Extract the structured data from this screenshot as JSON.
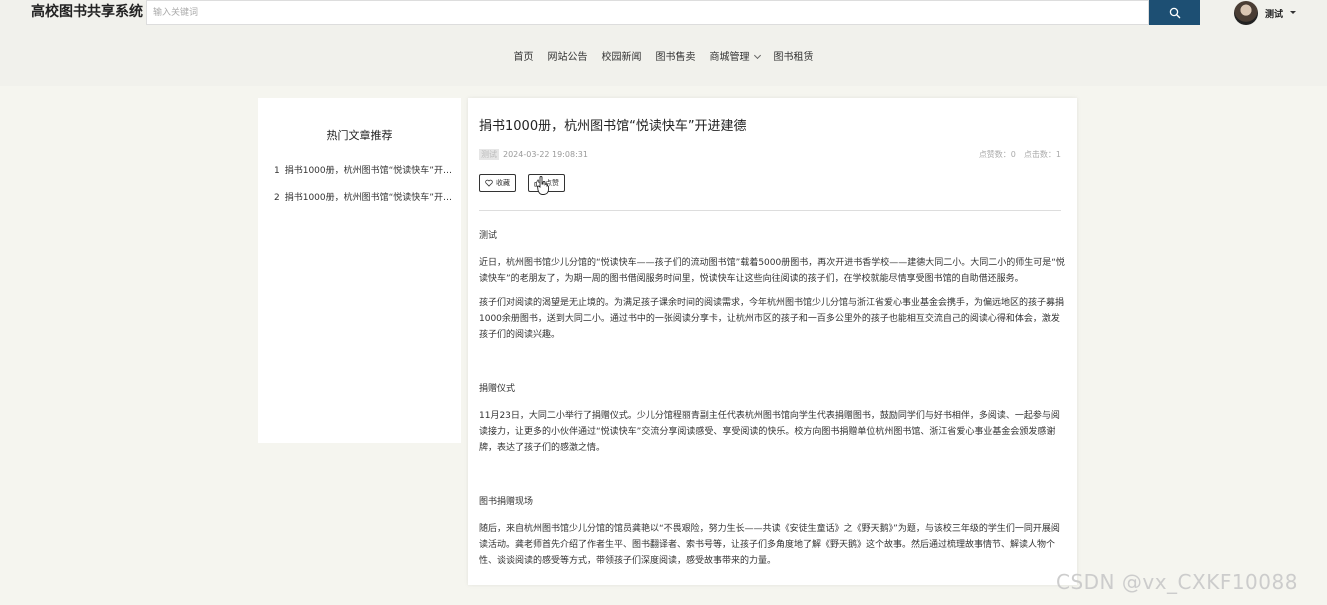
{
  "header": {
    "brand": "高校图书共享系统",
    "search_placeholder": "输入关键词",
    "user_name": "测试"
  },
  "nav": {
    "items": [
      "首页",
      "网站公告",
      "校园新闻",
      "图书售卖",
      "商城管理",
      "图书租赁"
    ]
  },
  "sidebar": {
    "title": "热门文章推荐",
    "items": [
      {
        "num": "1",
        "text": "捐书1000册，杭州图书馆“悦读快车”开进建德"
      },
      {
        "num": "2",
        "text": "捐书1000册，杭州图书馆“悦读快车”开进建德"
      }
    ]
  },
  "article": {
    "title": "捐书1000册，杭州图书馆“悦读快车”开进建德",
    "author": "测试",
    "datetime": "2024-03-22 19:08:31",
    "likes_label": "点赞数：0",
    "clicks_label": "点击数：1",
    "collect_label": "收藏",
    "like_label": "点赞",
    "sections": [
      {
        "heading": "测试",
        "paras": [
          "近日，杭州图书馆少儿分馆的“悦读快车——孩子们的流动图书馆”载着5000册图书，再次开进书香学校——建德大同二小。大同二小的师生可是“悦读快车”的老朋友了，为期一周的图书借阅服务时间里，悦读快车让这些向往阅读的孩子们，在学校就能尽情享受图书馆的自助借还服务。",
          "孩子们对阅读的渴望是无止境的。为满足孩子课余时间的阅读需求，今年杭州图书馆少儿分馆与浙江省爱心事业基金会携手，为偏远地区的孩子募捐1000余册图书，送到大同二小。通过书中的一张阅读分享卡，让杭州市区的孩子和一百多公里外的孩子也能相互交流自己的阅读心得和体会，激发孩子们的阅读兴趣。"
        ]
      },
      {
        "heading": "捐赠仪式",
        "paras": [
          "11月23日，大同二小举行了捐赠仪式。少儿分馆程丽青副主任代表杭州图书馆向学生代表捐赠图书，鼓励同学们与好书相伴，多阅读、一起参与阅读接力，让更多的小伙伴通过“悦读快车”交流分享阅读感受、享受阅读的快乐。校方向图书捐赠单位杭州图书馆、浙江省爱心事业基金会颁发感谢牌，表达了孩子们的感激之情。"
        ]
      },
      {
        "heading": "图书捐赠现场",
        "paras": [
          "随后，来自杭州图书馆少儿分馆的馆员龚艳以“不畏艰险，努力生长——共读《安徒生童话》之《野天鹅》”为题，与该校三年级的学生们一同开展阅读活动。龚老师首先介绍了作者生平、图书翻译者、索书号等，让孩子们多角度地了解《野天鹅》这个故事。然后通过梳理故事情节、解读人物个性、谈谈阅读的感受等方式，带领孩子们深度阅读，感受故事带来的力量。"
        ]
      }
    ]
  },
  "watermark": "CSDN @vx_CXKF10088",
  "colors": {
    "accent": "#1d4f73",
    "page_bg": "#f5f5ef"
  }
}
